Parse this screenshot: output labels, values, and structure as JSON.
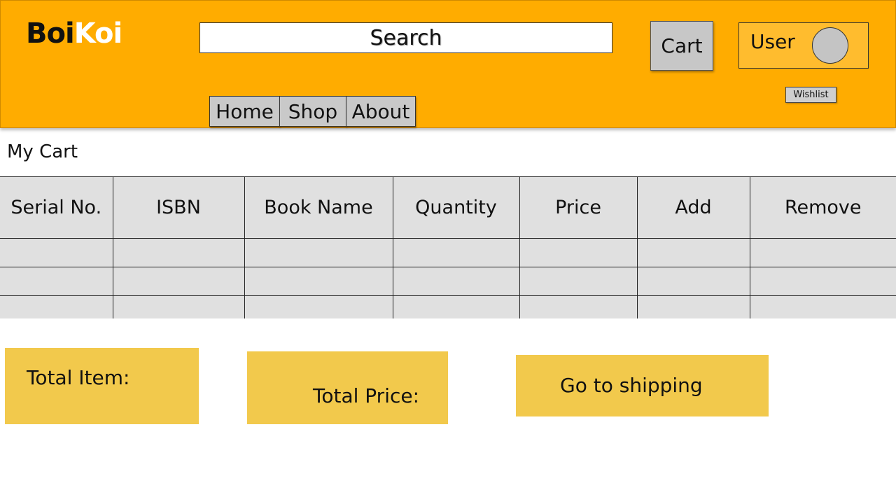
{
  "header": {
    "logo": {
      "part1": "Boi",
      "part2": "Koi"
    },
    "search": {
      "label": "Search"
    },
    "cart_label": "Cart",
    "user_label": "User",
    "wishlist_label": "Wishlist",
    "nav": [
      {
        "label": "Home"
      },
      {
        "label": "Shop"
      },
      {
        "label": "About"
      }
    ]
  },
  "main": {
    "title": "My Cart",
    "table": {
      "columns": [
        "Serial No.",
        "ISBN",
        "Book Name",
        "Quantity",
        "Price",
        "Add",
        "Remove"
      ],
      "rows": [
        [
          "",
          "",
          "",
          "",
          "",
          "",
          ""
        ],
        [
          "",
          "",
          "",
          "",
          "",
          "",
          ""
        ],
        [
          "",
          "",
          "",
          "",
          "",
          "",
          ""
        ]
      ]
    },
    "summary": {
      "total_items_label": "Total Item:",
      "total_price_label": "Total Price:",
      "shipping_button": "Go to shipping"
    }
  },
  "colors": {
    "header_bg": "#FFAC00",
    "user_box_bg": "#FFBC2E",
    "summary_bg": "#F2C94C",
    "table_bg": "#E0E0E0",
    "button_gray": "#C7C7C7"
  }
}
